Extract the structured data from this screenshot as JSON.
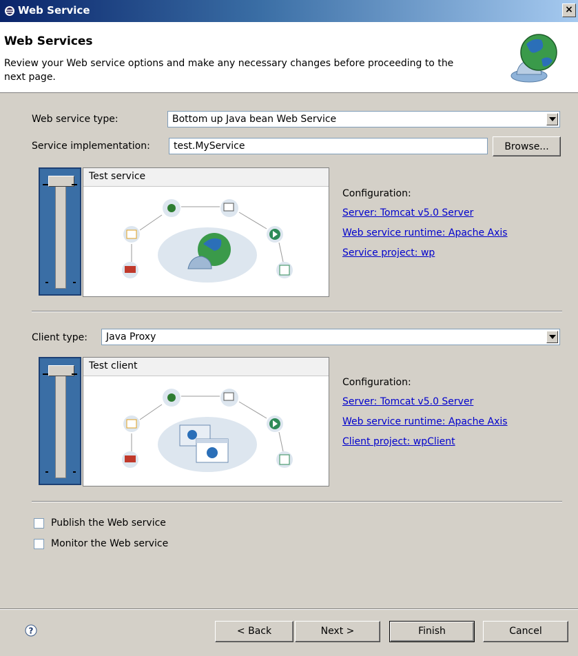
{
  "window": {
    "title": "Web Service"
  },
  "banner": {
    "title": "Web Services",
    "description": "Review your Web service options and make any necessary changes before proceeding to the next page."
  },
  "service": {
    "type_label": "Web service type:",
    "type_value": "Bottom up Java bean Web Service",
    "impl_label": "Service implementation:",
    "impl_value": "test.MyService",
    "browse_label": "Browse...",
    "slider_level": "Test service",
    "config_label": "Configuration:",
    "links": [
      "Server: Tomcat v5.0 Server",
      "Web service runtime: Apache Axis",
      "Service project: wp"
    ]
  },
  "client": {
    "type_label": "Client type:",
    "type_value": "Java Proxy",
    "slider_level": "Test client",
    "config_label": "Configuration:",
    "links": [
      "Server: Tomcat v5.0 Server",
      "Web service runtime: Apache Axis",
      "Client project: wpClient"
    ]
  },
  "options": {
    "publish_label": "Publish the Web service",
    "publish_checked": false,
    "monitor_label": "Monitor the Web service",
    "monitor_checked": false
  },
  "footer": {
    "help_icon": "help-icon",
    "back_label": "< Back",
    "next_label": "Next >",
    "finish_label": "Finish",
    "cancel_label": "Cancel"
  },
  "colors": {
    "title_bar": "#0a246a",
    "dialog_bg": "#d4d0c8",
    "slider": "#3a6ea5",
    "link": "#0000cc"
  }
}
